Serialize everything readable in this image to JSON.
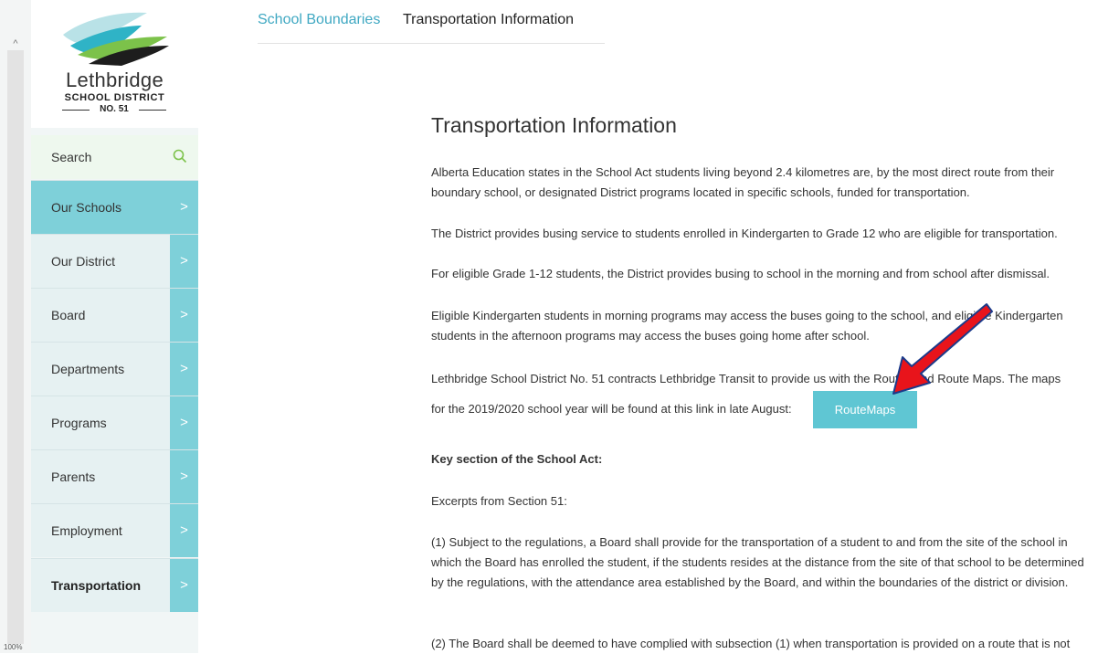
{
  "browser": {
    "zoom_label": "100%"
  },
  "sidebar": {
    "logo": {
      "name": "Lethbridge",
      "subtitle": "SCHOOL DISTRICT",
      "number": "NO. 51"
    },
    "search": {
      "label": "Search",
      "icon": "search-icon"
    },
    "items": [
      {
        "label": "Our Schools"
      },
      {
        "label": "Our District"
      },
      {
        "label": "Board"
      },
      {
        "label": "Departments"
      },
      {
        "label": "Programs"
      },
      {
        "label": "Parents"
      },
      {
        "label": "Employment"
      },
      {
        "label": "Transportation"
      }
    ]
  },
  "tabs": [
    {
      "label": "School Boundaries"
    },
    {
      "label": "Transportation Information"
    }
  ],
  "content": {
    "title": "Transportation Information",
    "paragraphs": [
      "Alberta Education states in the School Act students living beyond 2.4 kilometres are, by the most direct route from their boundary school, or designated District programs located in specific schools, funded for transportation.",
      "The District provides busing service to students enrolled in Kindergarten to Grade 12 who are eligible for transportation.",
      "For eligible Grade 1-12 students, the District provides busing to school in the morning and from school after dismissal.",
      "Eligible Kindergarten students in morning programs may access the buses going to the school, and eligible Kindergarten students in the afternoon programs may access the buses going home after school.",
      "Lethbridge School District No. 51 contracts Lethbridge Transit to provide us with the Routes and Route Maps. The maps",
      "for the 2019/2020 school year will be found at this link in late August:",
      "Key section of the School Act:",
      "Excerpts from Section 51:",
      "(1) Subject to the regulations, a Board shall provide for the transportation of a student to and from the site of the school in which the Board has enrolled the student, if the students resides at the distance from the site of that school to be determined by the regulations, with the attendance area established by the Board, and within the boundaries of the district or division.",
      "(2) The Board shall be deemed to have complied with subsection (1) when transportation is provided on a route that is not"
    ],
    "route_button": "RouteMaps"
  },
  "colors": {
    "accent": "#7ed0d9",
    "tab_active": "#3fa8c2",
    "button": "#5fc6d3",
    "annotation_arrow": "#e8141b"
  }
}
